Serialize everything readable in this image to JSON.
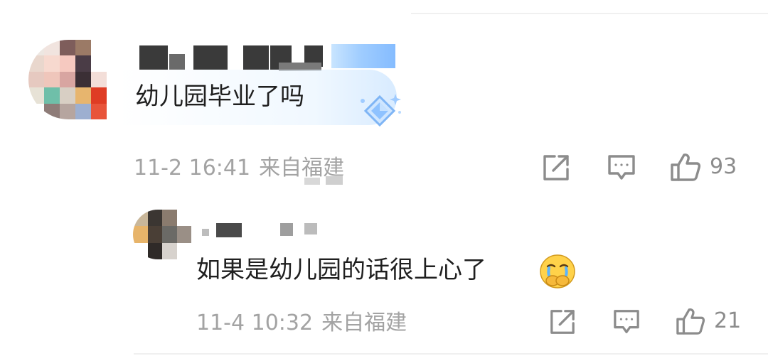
{
  "comments": [
    {
      "text": "幼儿园毕业了吗",
      "time": "11-2 16:41",
      "location": "来自福建",
      "like_count": "93"
    },
    {
      "text": "如果是幼儿园的话很上心了",
      "time": "11-4 10:32",
      "location": "来自福建",
      "like_count": "21",
      "emoji": "crying-covering-mouth-emoji"
    }
  ],
  "icons": {
    "share": "share-icon",
    "comment": "comment-icon",
    "like": "thumbs-up-icon",
    "badge": "diamond-badge-icon"
  },
  "colors": {
    "meta_text": "#a3a3a3",
    "icon_gray": "#8c8c8c",
    "body_text": "#1f1f1f",
    "badge_blue": "#6fb0ff"
  }
}
